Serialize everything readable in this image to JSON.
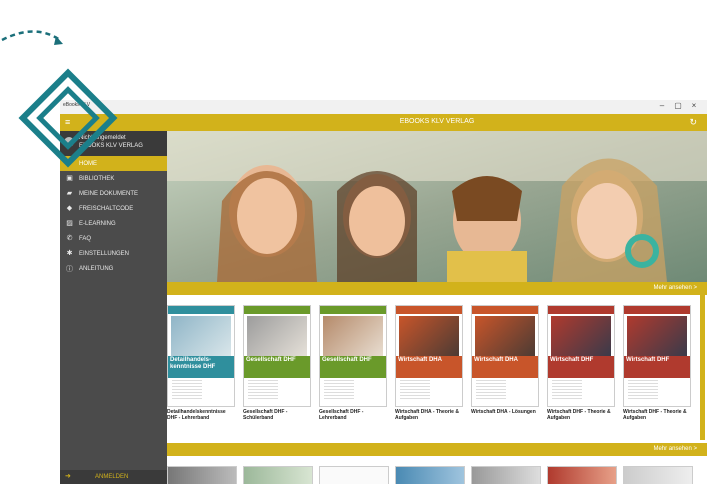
{
  "window": {
    "app_title": "eBooks KLV",
    "minimize": "–",
    "maximize": "▢",
    "close": "×"
  },
  "topbar": {
    "title": "EBOOKS KLV VERLAG"
  },
  "sidebar": {
    "account_line1": "Nicht angemeldet",
    "account_line2": "EBOOKS KLV VERLAG",
    "items": [
      {
        "label": "HOME",
        "icon": "home-icon",
        "active": true
      },
      {
        "label": "BIBLIOTHEK",
        "icon": "library-icon"
      },
      {
        "label": "MEINE DOKUMENTE",
        "icon": "folder-icon"
      },
      {
        "label": "FREISCHALTCODE",
        "icon": "tag-icon"
      },
      {
        "label": "E-LEARNING",
        "icon": "elearning-icon"
      },
      {
        "label": "FAQ",
        "icon": "phone-icon"
      },
      {
        "label": "EINSTELLUNGEN",
        "icon": "gear-icon"
      },
      {
        "label": "ANLEITUNG",
        "icon": "info-icon"
      }
    ],
    "login_label": "ANMELDEN"
  },
  "section1": {
    "more_label": "Mehr ansehen >"
  },
  "section2": {
    "more_label": "Mehr ansehen >"
  },
  "books": [
    {
      "title": "Detailhandelskenntnisse DHF - Lehrerband",
      "cover_text": "Detailhandels-kenntnisse DHF",
      "color": "#2f8f9d"
    },
    {
      "title": "Gesellschaft DHF - Schülerband",
      "cover_text": "Gesellschaft DHF",
      "color": "#6a9a2a"
    },
    {
      "title": "Gesellschaft DHF - Lehrerband",
      "cover_text": "Gesellschaft DHF",
      "color": "#6a9a2a"
    },
    {
      "title": "Wirtschaft DHA - Theorie & Aufgaben",
      "cover_text": "Wirtschaft DHA",
      "color": "#c8552a"
    },
    {
      "title": "Wirtschaft DHA - Lösungen",
      "cover_text": "Wirtschaft DHA",
      "color": "#c8552a"
    },
    {
      "title": "Wirtschaft DHF - Theorie & Aufgaben",
      "cover_text": "Wirtschaft DHF",
      "color": "#b03a2e"
    },
    {
      "title": "Wirtschaft DHF - Theorie & Aufgaben",
      "cover_text": "Wirtschaft DHF",
      "color": "#b03a2e"
    }
  ],
  "colors": {
    "accent": "#d2b21b",
    "sidebar": "#4b4b4b",
    "teal": "#1b7f8a"
  }
}
